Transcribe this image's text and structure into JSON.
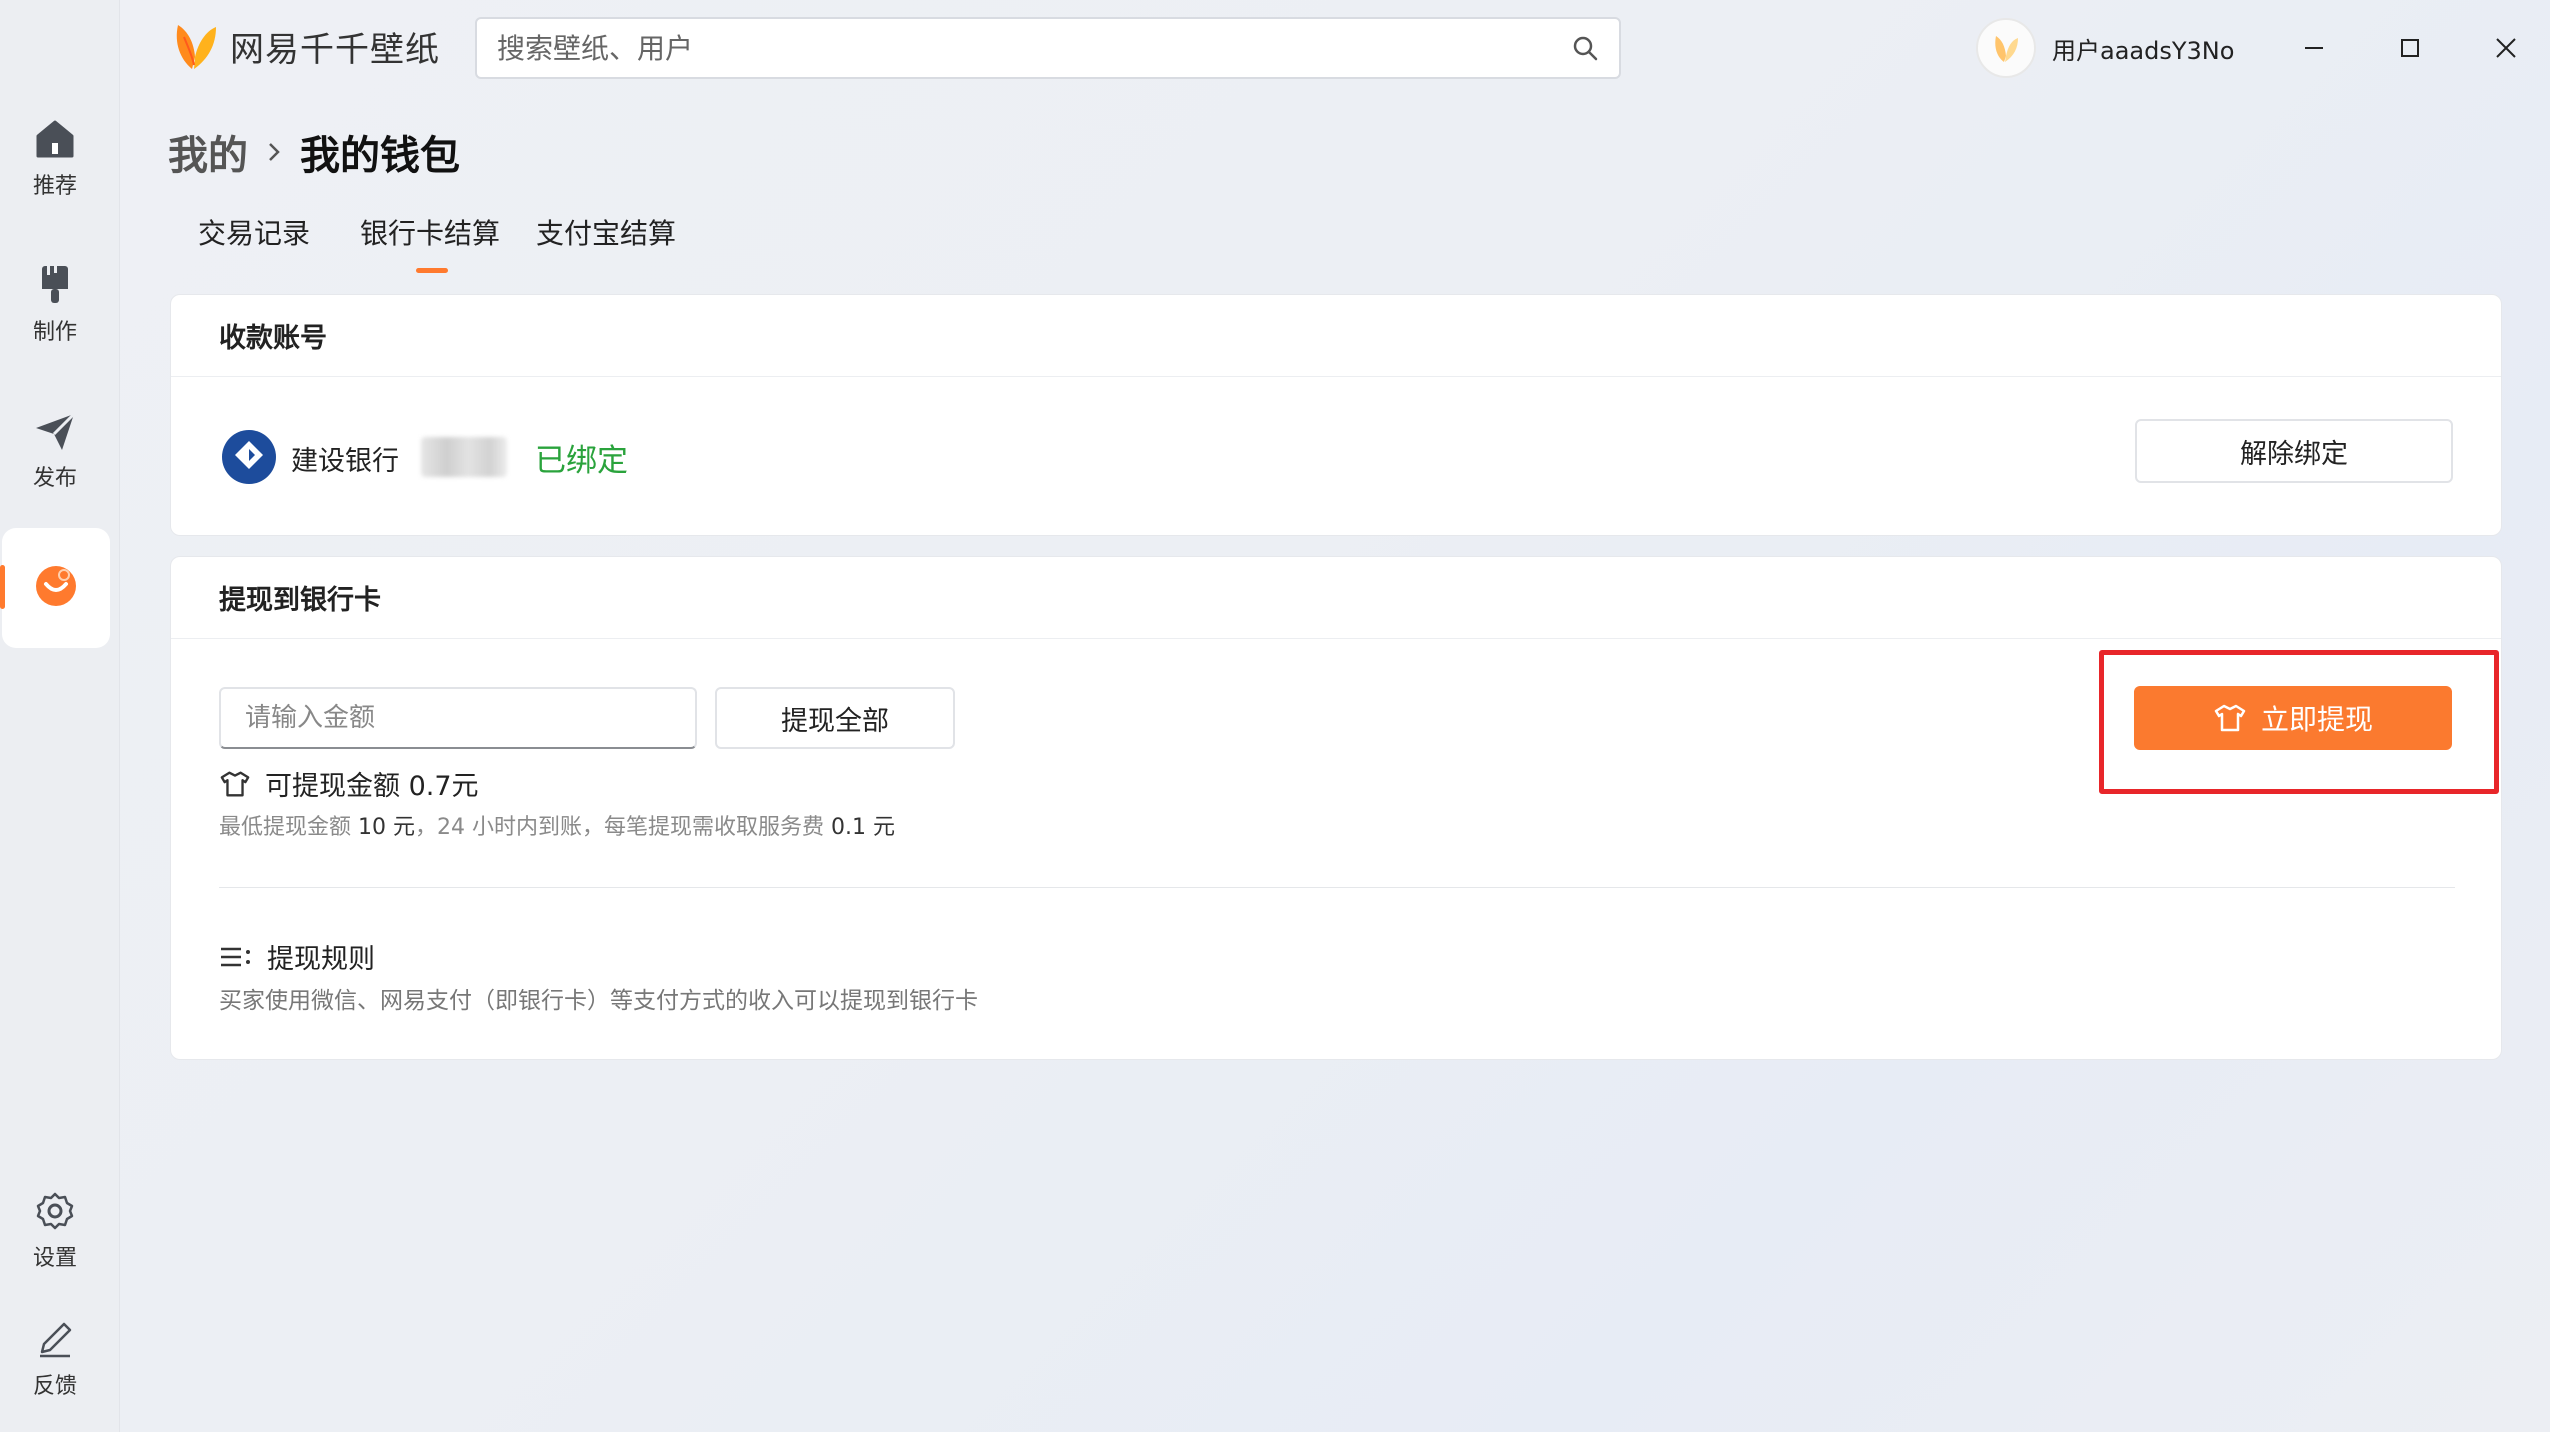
{
  "app": {
    "name": "网易千千壁纸",
    "search_placeholder": "搜索壁纸、用户",
    "user_name": "用户aaadsY3No"
  },
  "sidebar": {
    "items": [
      {
        "label": "推荐",
        "icon": "home-icon"
      },
      {
        "label": "制作",
        "icon": "brush-icon"
      },
      {
        "label": "发布",
        "icon": "send-icon"
      },
      {
        "label": "",
        "icon": "profile-orange-icon",
        "active": true
      },
      {
        "label": "设置",
        "icon": "gear-icon"
      },
      {
        "label": "反馈",
        "icon": "pencil-icon"
      }
    ]
  },
  "breadcrumb": {
    "parent": "我的",
    "current": "我的钱包"
  },
  "tabs": [
    {
      "label": "交易记录"
    },
    {
      "label": "银行卡结算",
      "active": true
    },
    {
      "label": "支付宝结算"
    }
  ],
  "account_card": {
    "title": "收款账号",
    "bank_name": "建设银行",
    "status": "已绑定",
    "unbind_label": "解除绑定"
  },
  "withdraw_card": {
    "title": "提现到银行卡",
    "amount_placeholder": "请输入金额",
    "withdraw_all_label": "提现全部",
    "withdraw_now_label": "立即提现",
    "available_text": "可提现金额 0.7元",
    "hint_prefix": "最低提现金额",
    "hint_min": "10 元",
    "hint_middle": "，24 小时内到账，每笔提现需收取服务费",
    "hint_fee": "0.1 元",
    "rules_title": "提现规则",
    "rules_desc": "买家使用微信、网易支付（即银行卡）等支付方式的收入可以提现到银行卡"
  },
  "colors": {
    "accent": "#fb7a2f",
    "success": "#2aa33c",
    "highlight": "#e8262a"
  }
}
